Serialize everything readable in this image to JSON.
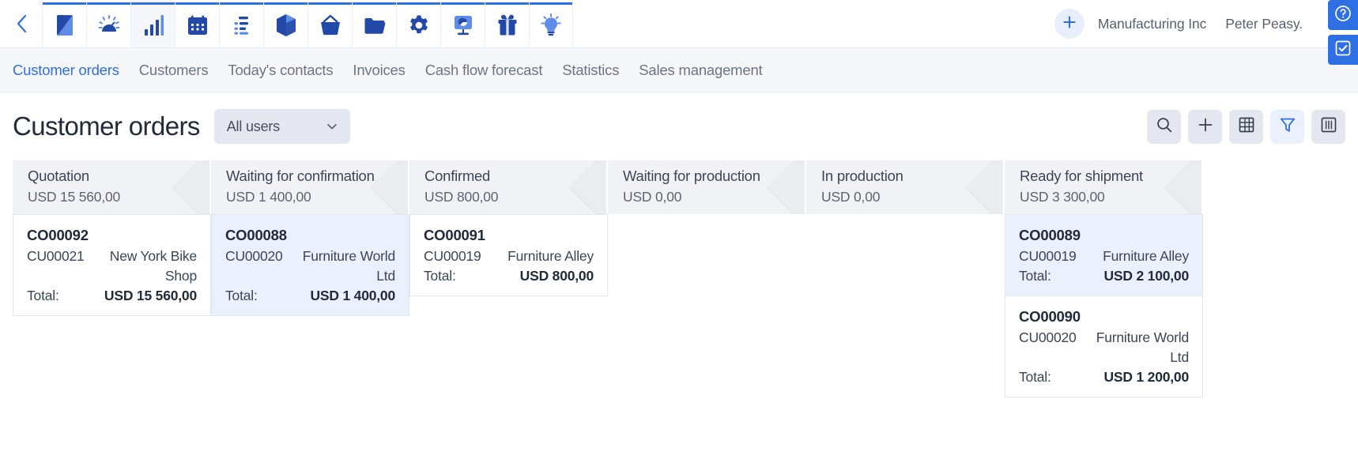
{
  "appbar": {
    "back_icon": "chevron-left-icon",
    "modules": [
      {
        "name": "dashboard-module",
        "icon": "square-split-icon",
        "active": false
      },
      {
        "name": "performance-module",
        "icon": "gauge-icon",
        "active": false
      },
      {
        "name": "analytics-module",
        "icon": "bar-chart-icon",
        "active": true
      },
      {
        "name": "calendar-module",
        "icon": "calendar-icon",
        "active": false
      },
      {
        "name": "tasks-module",
        "icon": "list-icon",
        "active": false
      },
      {
        "name": "products-module",
        "icon": "cube-icon",
        "active": false
      },
      {
        "name": "purchases-module",
        "icon": "basket-icon",
        "active": false
      },
      {
        "name": "documents-module",
        "icon": "folder-icon",
        "active": false
      },
      {
        "name": "settings-module",
        "icon": "gear-icon",
        "active": false
      },
      {
        "name": "marketing-module",
        "icon": "presentation-icon",
        "active": false
      },
      {
        "name": "gifts-module",
        "icon": "gift-icon",
        "active": false
      },
      {
        "name": "ideas-module",
        "icon": "lightbulb-icon",
        "active": false
      }
    ],
    "add_label": "+",
    "organization": "Manufacturing Inc",
    "user": "Peter Peasy.",
    "logout_icon": "logout-icon",
    "edge_buttons": [
      {
        "name": "help-button",
        "icon": "question-mark-icon"
      },
      {
        "name": "tasks-check-button",
        "icon": "checkbox-icon"
      }
    ]
  },
  "section_nav": {
    "items": [
      {
        "label": "Customer orders",
        "active": true
      },
      {
        "label": "Customers",
        "active": false
      },
      {
        "label": "Today's contacts",
        "active": false
      },
      {
        "label": "Invoices",
        "active": false
      },
      {
        "label": "Cash flow forecast",
        "active": false
      },
      {
        "label": "Statistics",
        "active": false
      },
      {
        "label": "Sales management",
        "active": false
      }
    ]
  },
  "page": {
    "title": "Customer orders",
    "user_filter": "All users",
    "user_filter_icon": "chevron-down-icon"
  },
  "toolbar": {
    "buttons": [
      {
        "name": "search-button",
        "icon": "search-icon",
        "accent": false
      },
      {
        "name": "add-order-button",
        "icon": "plus-icon",
        "accent": false
      },
      {
        "name": "table-view-button",
        "icon": "table-icon",
        "accent": false
      },
      {
        "name": "filter-button",
        "icon": "funnel-icon",
        "accent": true
      },
      {
        "name": "columns-button",
        "icon": "columns-icon",
        "accent": false
      }
    ]
  },
  "kanban": {
    "columns": [
      {
        "title": "Quotation",
        "sum": "USD 15 560,00",
        "cards": [
          {
            "id": "CO00092",
            "customer_id": "CU00021",
            "customer_name": "New York Bike Shop",
            "total_label": "Total:",
            "total_value": "USD 15 560,00",
            "selected": false
          }
        ]
      },
      {
        "title": "Waiting for confirmation",
        "sum": "USD 1 400,00",
        "cards": [
          {
            "id": "CO00088",
            "customer_id": "CU00020",
            "customer_name": "Furniture World Ltd",
            "total_label": "Total:",
            "total_value": "USD 1 400,00",
            "selected": true
          }
        ]
      },
      {
        "title": "Confirmed",
        "sum": "USD 800,00",
        "cards": [
          {
            "id": "CO00091",
            "customer_id": "CU00019",
            "customer_name": "Furniture Alley",
            "total_label": "Total:",
            "total_value": "USD 800,00",
            "selected": false
          }
        ]
      },
      {
        "title": "Waiting for production",
        "sum": "USD 0,00",
        "cards": []
      },
      {
        "title": "In production",
        "sum": "USD 0,00",
        "cards": []
      },
      {
        "title": "Ready for shipment",
        "sum": "USD 3 300,00",
        "cards": [
          {
            "id": "CO00089",
            "customer_id": "CU00019",
            "customer_name": "Furniture Alley",
            "total_label": "Total:",
            "total_value": "USD 2 100,00",
            "selected": true
          },
          {
            "id": "CO00090",
            "customer_id": "CU00020",
            "customer_name": "Furniture World Ltd",
            "total_label": "Total:",
            "total_value": "USD 1 200,00",
            "selected": false
          }
        ]
      }
    ]
  },
  "colors": {
    "accent": "#2f6fe4",
    "selected_card": "#eaf0fc",
    "header_bg": "#f1f2f5",
    "nav_bg": "#f6f7fa"
  }
}
